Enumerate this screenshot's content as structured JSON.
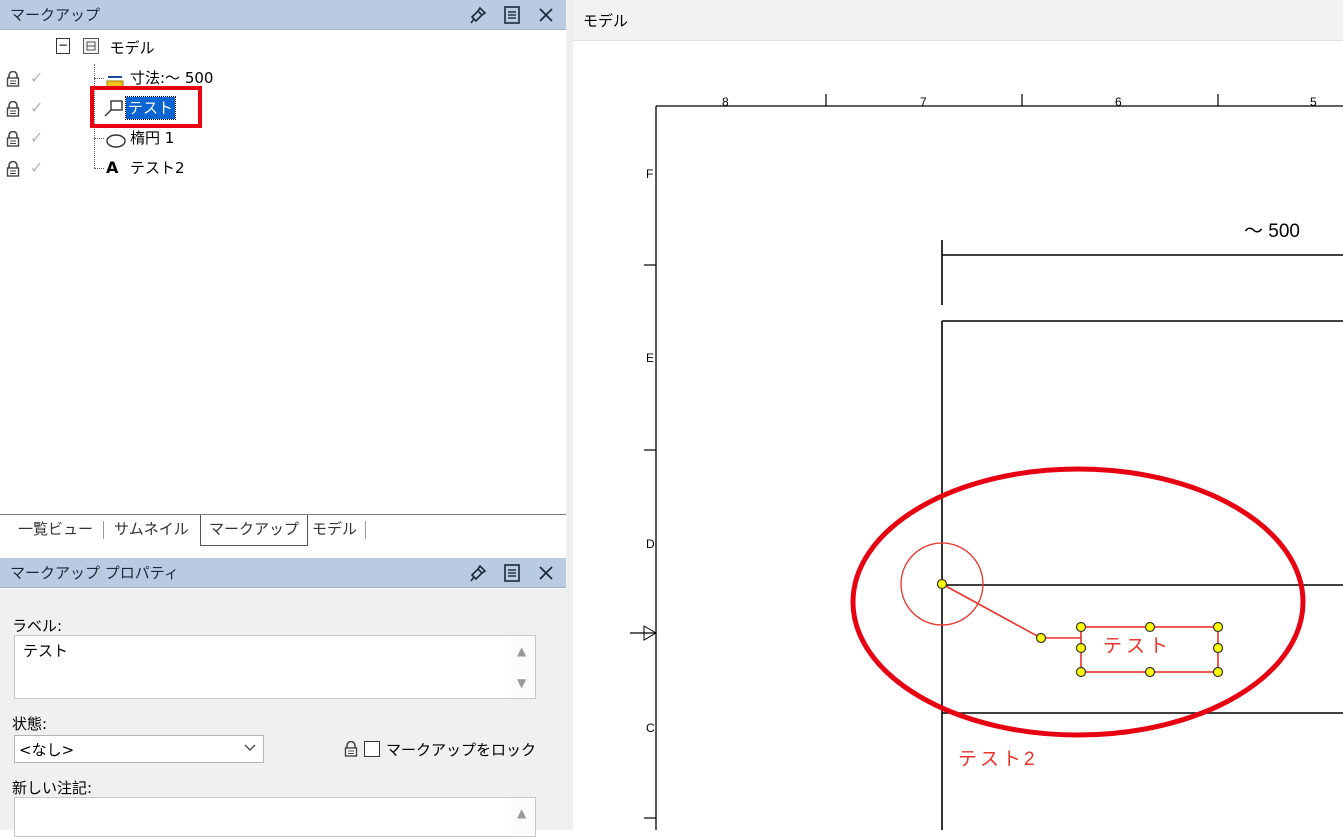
{
  "markup_panel": {
    "title": "マークアップ",
    "tree": {
      "root_label": "モデル",
      "items": [
        {
          "label": "寸法:～ 500",
          "icon": "dimension-icon"
        },
        {
          "label": "テスト",
          "icon": "callout-icon",
          "selected": true
        },
        {
          "label": "楕円 1",
          "icon": "ellipse-icon"
        },
        {
          "label": "テスト2",
          "icon": "text-icon"
        }
      ]
    },
    "text_glyph": "A"
  },
  "tabs": [
    "一覧ビュー",
    "サムネイル",
    "マークアップ",
    "モデル"
  ],
  "properties_panel": {
    "title": "マークアップ プロパティ",
    "label_caption": "ラベル:",
    "label_value": "テスト",
    "state_caption": "状態:",
    "state_value": "<なし>",
    "lock_caption": "マークアップをロック",
    "new_note_caption": "新しい注記:"
  },
  "drawing": {
    "title": "モデル",
    "col_labels": [
      "8",
      "7",
      "6",
      "5"
    ],
    "row_labels": [
      "F",
      "E",
      "D",
      "C"
    ],
    "dimension_text": "～ 500",
    "callout_text": "テスト",
    "text_markup": "テスト2"
  },
  "colors": {
    "markup_red": "#e8332a",
    "highlight_red": "#e60012",
    "selection_blue": "#0a64d2",
    "handle_yellow": "#ffff00",
    "title_bar": "#b9cbe0"
  }
}
